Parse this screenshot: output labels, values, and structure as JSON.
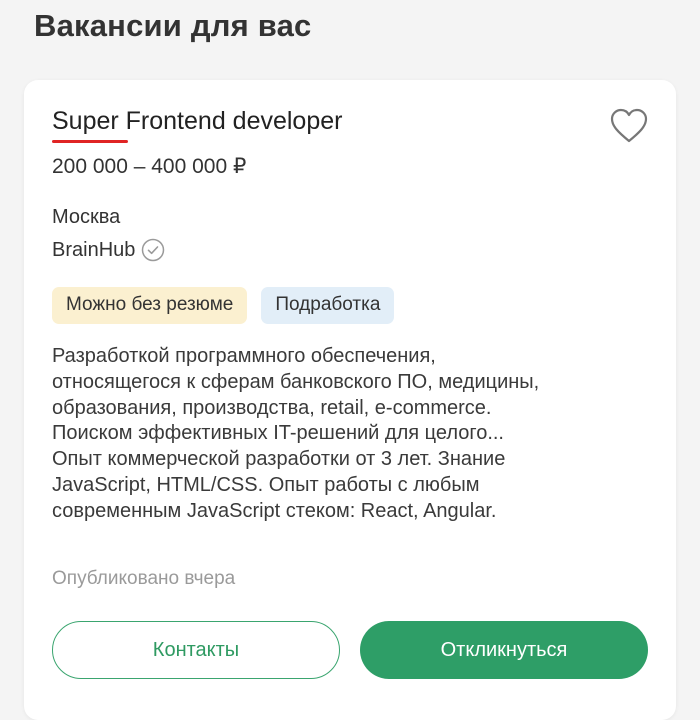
{
  "page": {
    "title": "Вакансии для вас"
  },
  "vacancy": {
    "title": "Super Frontend developer",
    "salary": "200 000 – 400 000 ₽",
    "city": "Москва",
    "company": "BrainHub",
    "tags": [
      {
        "label": "Можно без резюме",
        "color": "#fbf0d0"
      },
      {
        "label": "Подработка",
        "color": "#e2eef8"
      }
    ],
    "description_lines": [
      "Разработкой программного обеспечения,",
      "относящегося к сферам банковского ПО, медицины,",
      "образования, производства, retail, e-commerce.",
      "Поиском эффективных IT-решений для целого...",
      "Опыт коммерческой разработки от 3 лет. Знание",
      "JavaScript, HTML/CSS. Опыт работы с любым",
      "современным JavaScript стеком: React, Angular."
    ],
    "published": "Опубликовано вчера",
    "icons": {
      "favorite": "heart-outline-icon",
      "verified": "check-circle-icon"
    }
  },
  "actions": {
    "contacts_label": "Контакты",
    "apply_label": "Откликнуться"
  },
  "colors": {
    "accent": "#2e9e67",
    "spellcheck": "#e02424"
  }
}
